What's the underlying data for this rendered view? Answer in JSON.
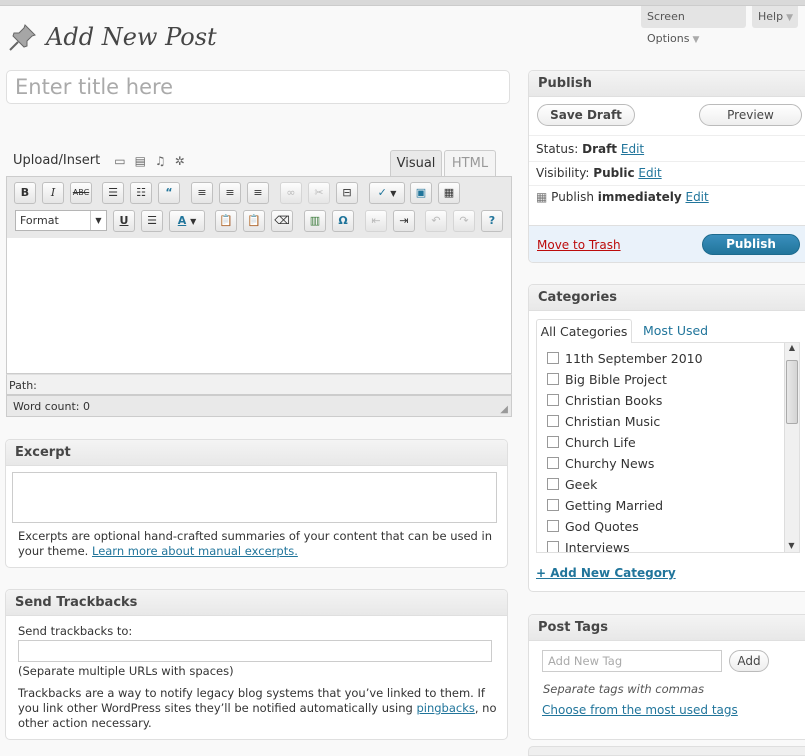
{
  "header": {
    "screen_options": "Screen Options",
    "help": "Help",
    "page_title": "Add New Post"
  },
  "title_input": {
    "placeholder": "Enter title here"
  },
  "editor": {
    "upload_label": "Upload/Insert",
    "tab_visual": "Visual",
    "tab_html": "HTML",
    "format_label": "Format",
    "path_label": "Path:",
    "word_count": "Word count: 0",
    "buttons": [
      "B",
      "I",
      "ABC",
      "U",
      "A",
      "Ω"
    ]
  },
  "excerpt": {
    "title": "Excerpt",
    "help_text": "Excerpts are optional hand-crafted summaries of your content that can be used in your theme.",
    "help_link": "Learn more about manual excerpts."
  },
  "trackbacks": {
    "title": "Send Trackbacks",
    "label": "Send trackbacks to:",
    "note": "(Separate multiple URLs with spaces)",
    "desc_before": "Trackbacks are a way to notify legacy blog systems that you’ve linked to them. If you link other WordPress sites they’ll be notified automatically using ",
    "desc_link": "pingbacks",
    "desc_after": ", no other action necessary."
  },
  "publish": {
    "title": "Publish",
    "save_draft": "Save Draft",
    "preview": "Preview",
    "status_label": "Status:",
    "status_value": "Draft",
    "visibility_label": "Visibility:",
    "visibility_value": "Public",
    "publish_label": "Publish",
    "publish_value": "immediately",
    "edit": "Edit",
    "trash": "Move to Trash",
    "publish_button": "Publish"
  },
  "categories": {
    "title": "Categories",
    "tab_all": "All Categories",
    "tab_most_used": "Most Used",
    "items": [
      "11th September 2010",
      "Big Bible Project",
      "Christian Books",
      "Christian Music",
      "Church Life",
      "Churchy News",
      "Geek",
      "Getting Married",
      "God Quotes",
      "Interviews"
    ],
    "add_new": "+ Add New Category"
  },
  "tags": {
    "title": "Post Tags",
    "placeholder": "Add New Tag",
    "add_button": "Add",
    "hint": "Separate tags with commas",
    "choose_link": "Choose from the most used tags"
  },
  "colors": {
    "link": "#21759b",
    "publish_button": "#21759b",
    "trash": "#bc0b0b"
  }
}
